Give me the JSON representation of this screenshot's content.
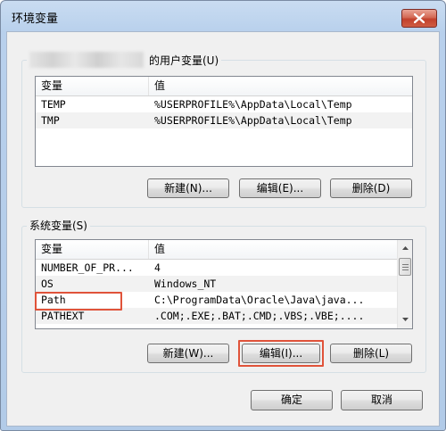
{
  "window": {
    "title": "环境变量"
  },
  "user_vars": {
    "group_label": "的用户变量(U)",
    "columns": [
      "变量",
      "值"
    ],
    "rows": [
      {
        "name": "TEMP",
        "value": "%USERPROFILE%\\AppData\\Local\\Temp"
      },
      {
        "name": "TMP",
        "value": "%USERPROFILE%\\AppData\\Local\\Temp"
      }
    ],
    "buttons": {
      "new": "新建(N)...",
      "edit": "编辑(E)...",
      "delete": "删除(D)"
    }
  },
  "system_vars": {
    "group_label": "系统变量(S)",
    "columns": [
      "变量",
      "值"
    ],
    "rows": [
      {
        "name": "NUMBER_OF_PR...",
        "value": "4"
      },
      {
        "name": "OS",
        "value": "Windows_NT"
      },
      {
        "name": "Path",
        "value": "C:\\ProgramData\\Oracle\\Java\\java..."
      },
      {
        "name": "PATHEXT",
        "value": ".COM;.EXE;.BAT;.CMD;.VBS;.VBE;...."
      }
    ],
    "buttons": {
      "new": "新建(W)...",
      "edit": "编辑(I)...",
      "delete": "删除(L)"
    }
  },
  "dialog_buttons": {
    "ok": "确定",
    "cancel": "取消"
  },
  "accent": {
    "highlight": "#e0533a",
    "close_button": "#c2412c"
  }
}
